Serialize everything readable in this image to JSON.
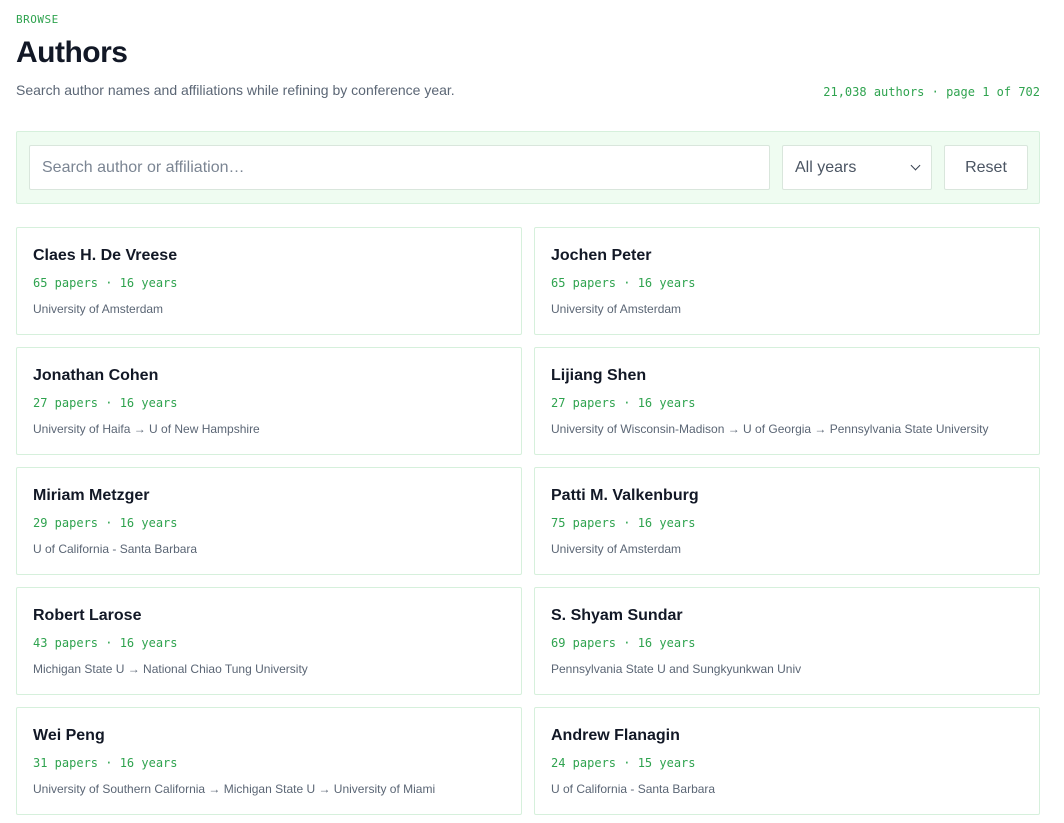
{
  "header": {
    "eyebrow": "BROWSE",
    "title": "Authors",
    "subtitle": "Search author names and affiliations while refining by conference year.",
    "count": "21,038 authors · page 1 of 702"
  },
  "filters": {
    "search_placeholder": "Search author or affiliation…",
    "search_value": "",
    "year_selected": "All years",
    "reset_label": "Reset"
  },
  "authors": [
    {
      "name": "Claes H. De Vreese",
      "meta": "65 papers · 16 years",
      "affiliation": "University of Amsterdam"
    },
    {
      "name": "Jochen Peter",
      "meta": "65 papers · 16 years",
      "affiliation": "University of Amsterdam"
    },
    {
      "name": "Jonathan Cohen",
      "meta": "27 papers · 16 years",
      "affiliation": "University of Haifa → U of New Hampshire"
    },
    {
      "name": "Lijiang Shen",
      "meta": "27 papers · 16 years",
      "affiliation": "University of Wisconsin-Madison → U of Georgia → Pennsylvania State University"
    },
    {
      "name": "Miriam Metzger",
      "meta": "29 papers · 16 years",
      "affiliation": "U of California - Santa Barbara"
    },
    {
      "name": "Patti M. Valkenburg",
      "meta": "75 papers · 16 years",
      "affiliation": "University of Amsterdam"
    },
    {
      "name": "Robert Larose",
      "meta": "43 papers · 16 years",
      "affiliation": "Michigan State U → National Chiao Tung University"
    },
    {
      "name": "S. Shyam Sundar",
      "meta": "69 papers · 16 years",
      "affiliation": "Pennsylvania State U and Sungkyunkwan Univ"
    },
    {
      "name": "Wei Peng",
      "meta": "31 papers · 16 years",
      "affiliation": "University of Southern California → Michigan State U → University of Miami"
    },
    {
      "name": "Andrew Flanagin",
      "meta": "24 papers · 15 years",
      "affiliation": "U of California - Santa Barbara"
    }
  ],
  "colors": {
    "accent": "#2fa34f",
    "filter_bg": "#effcf1",
    "border": "#d6f0dc"
  }
}
